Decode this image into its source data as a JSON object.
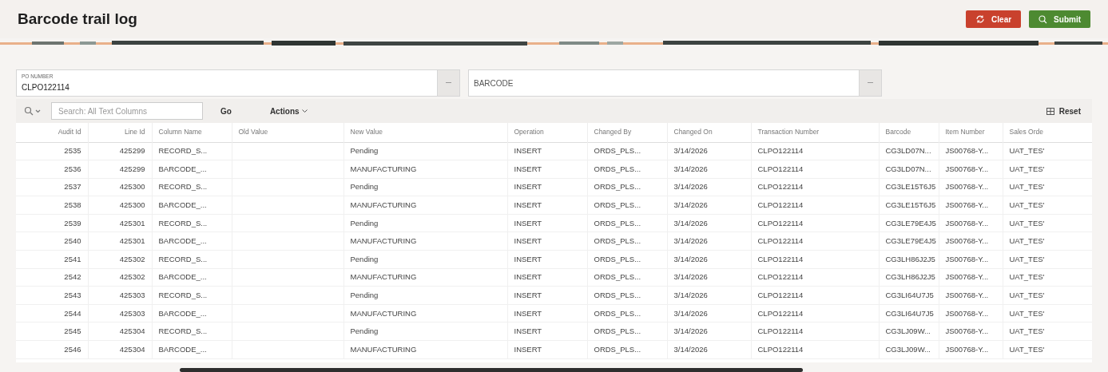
{
  "page": {
    "title": "Barcode trail log"
  },
  "buttons": [
    {
      "kind": "clear",
      "label": "Clear"
    },
    {
      "kind": "submit",
      "label": "Submit"
    }
  ],
  "filters": [
    {
      "label": "PO NUMBER",
      "value": "CLPO122114"
    },
    {
      "placeholder": "BARCODE"
    }
  ],
  "toolbar": {
    "search_placeholder": "Search: All Text Columns",
    "go": "Go",
    "actions": "Actions",
    "reset": "Reset"
  },
  "table": {
    "columns": [
      "Audit Id",
      "Line Id",
      "Column Name",
      "Old Value",
      "New Value",
      "Operation",
      "Changed By",
      "Changed On",
      "Transaction Number",
      "Barcode",
      "Item Number",
      "Sales Orde"
    ],
    "rows": [
      [
        "2535",
        "425299",
        "RECORD_S...",
        "",
        "Pending",
        "INSERT",
        "ORDS_PLS...",
        "3/14/2026",
        "CLPO122114",
        "CG3LD07N...",
        "JS00768-Y...",
        "UAT_TES'"
      ],
      [
        "2536",
        "425299",
        "BARCODE_...",
        "",
        "MANUFACTURING",
        "INSERT",
        "ORDS_PLS...",
        "3/14/2026",
        "CLPO122114",
        "CG3LD07N...",
        "JS00768-Y...",
        "UAT_TES'"
      ],
      [
        "2537",
        "425300",
        "RECORD_S...",
        "",
        "Pending",
        "INSERT",
        "ORDS_PLS...",
        "3/14/2026",
        "CLPO122114",
        "CG3LE15T6J5",
        "JS00768-Y...",
        "UAT_TES'"
      ],
      [
        "2538",
        "425300",
        "BARCODE_...",
        "",
        "MANUFACTURING",
        "INSERT",
        "ORDS_PLS...",
        "3/14/2026",
        "CLPO122114",
        "CG3LE15T6J5",
        "JS00768-Y...",
        "UAT_TES'"
      ],
      [
        "2539",
        "425301",
        "RECORD_S...",
        "",
        "Pending",
        "INSERT",
        "ORDS_PLS...",
        "3/14/2026",
        "CLPO122114",
        "CG3LE79E4J5",
        "JS00768-Y...",
        "UAT_TES'"
      ],
      [
        "2540",
        "425301",
        "BARCODE_...",
        "",
        "MANUFACTURING",
        "INSERT",
        "ORDS_PLS...",
        "3/14/2026",
        "CLPO122114",
        "CG3LE79E4J5",
        "JS00768-Y...",
        "UAT_TES'"
      ],
      [
        "2541",
        "425302",
        "RECORD_S...",
        "",
        "Pending",
        "INSERT",
        "ORDS_PLS...",
        "3/14/2026",
        "CLPO122114",
        "CG3LH86J2J5",
        "JS00768-Y...",
        "UAT_TES'"
      ],
      [
        "2542",
        "425302",
        "BARCODE_...",
        "",
        "MANUFACTURING",
        "INSERT",
        "ORDS_PLS...",
        "3/14/2026",
        "CLPO122114",
        "CG3LH86J2J5",
        "JS00768-Y...",
        "UAT_TES'"
      ],
      [
        "2543",
        "425303",
        "RECORD_S...",
        "",
        "Pending",
        "INSERT",
        "ORDS_PLS...",
        "3/14/2026",
        "CLPO122114",
        "CG3LI64U7J5",
        "JS00768-Y...",
        "UAT_TES'"
      ],
      [
        "2544",
        "425303",
        "BARCODE_...",
        "",
        "MANUFACTURING",
        "INSERT",
        "ORDS_PLS...",
        "3/14/2026",
        "CLPO122114",
        "CG3LI64U7J5",
        "JS00768-Y...",
        "UAT_TES'"
      ],
      [
        "2545",
        "425304",
        "RECORD_S...",
        "",
        "Pending",
        "INSERT",
        "ORDS_PLS...",
        "3/14/2026",
        "CLPO122114",
        "CG3LJ09W...",
        "JS00768-Y...",
        "UAT_TES'"
      ],
      [
        "2546",
        "425304",
        "BARCODE_...",
        "",
        "MANUFACTURING",
        "INSERT",
        "ORDS_PLS...",
        "3/14/2026",
        "CLPO122114",
        "CG3LJ09W...",
        "JS00768-Y...",
        "UAT_TES'"
      ]
    ]
  }
}
